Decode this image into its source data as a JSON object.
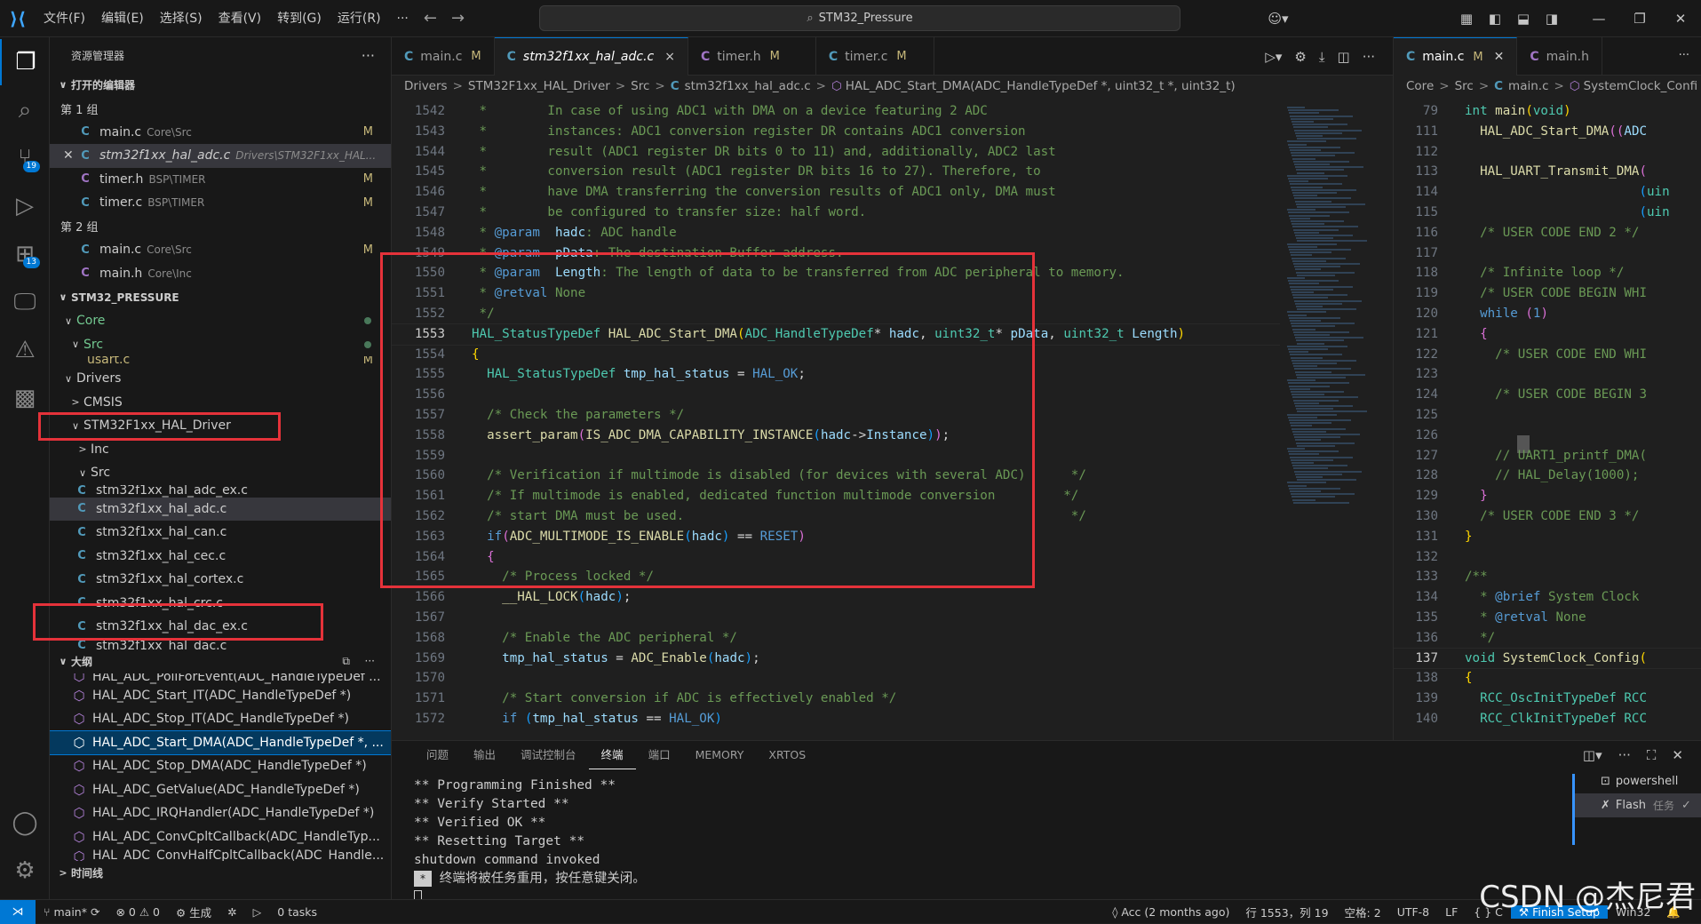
{
  "titlebar": {
    "menu": [
      "文件(F)",
      "编辑(E)",
      "选择(S)",
      "查看(V)",
      "转到(G)",
      "运行(R)",
      "···"
    ],
    "search": "STM32_Pressure"
  },
  "activity": {
    "scm_badge": "19",
    "ext_badge": "13"
  },
  "sidebar": {
    "title": "资源管理器",
    "open_editors_label": "打开的编辑器",
    "group1_label": "第 1 组",
    "group2_label": "第 2 组",
    "open_editors_g1": [
      {
        "name": "main.c",
        "path": "Core\\Src",
        "status": "M"
      },
      {
        "name": "stm32f1xx_hal_adc.c",
        "path": "Drivers\\STM32F1xx_HAL...",
        "status": ""
      },
      {
        "name": "timer.h",
        "path": "BSP\\TIMER",
        "status": "M"
      },
      {
        "name": "timer.c",
        "path": "BSP\\TIMER",
        "status": "M"
      }
    ],
    "open_editors_g2": [
      {
        "name": "main.c",
        "path": "Core\\Src",
        "status": "M"
      },
      {
        "name": "main.h",
        "path": "Core\\Inc",
        "status": ""
      }
    ],
    "project_label": "STM32_PRESSURE",
    "tree": {
      "core": "Core",
      "src": "Src",
      "usart": "usart.c",
      "usart_status": "M",
      "drivers": "Drivers",
      "cmsis": "CMSIS",
      "hal_driver": "STM32F1xx_HAL_Driver",
      "inc": "Inc",
      "src2": "Src",
      "files": [
        "stm32f1xx_hal_adc_ex.c",
        "stm32f1xx_hal_adc.c",
        "stm32f1xx_hal_can.c",
        "stm32f1xx_hal_cec.c",
        "stm32f1xx_hal_cortex.c",
        "stm32f1xx_hal_crc.c",
        "stm32f1xx_hal_dac_ex.c",
        "stm32f1xx_hal_dac.c"
      ]
    },
    "outline_label": "大纲",
    "outline": [
      "HAL_ADC_PollForEvent(ADC_HandleTypeDef ...",
      "HAL_ADC_Start_IT(ADC_HandleTypeDef *)",
      "HAL_ADC_Stop_IT(ADC_HandleTypeDef *)",
      "HAL_ADC_Start_DMA(ADC_HandleTypeDef *, ...",
      "HAL_ADC_Stop_DMA(ADC_HandleTypeDef *)",
      "HAL_ADC_GetValue(ADC_HandleTypeDef *)",
      "HAL_ADC_IRQHandler(ADC_HandleTypeDef *)",
      "HAL_ADC_ConvCpltCallback(ADC_HandleTyp...",
      "HAL_ADC_ConvHalfCpltCallback(ADC_Handle..."
    ],
    "timeline_label": "时间线"
  },
  "editor1": {
    "tabs": [
      {
        "name": "main.c",
        "status": "M"
      },
      {
        "name": "stm32f1xx_hal_adc.c",
        "status": "×"
      },
      {
        "name": "timer.h",
        "status": "M"
      },
      {
        "name": "timer.c",
        "status": "M"
      }
    ],
    "breadcrumb": [
      "Drivers",
      "STM32F1xx_HAL_Driver",
      "Src",
      "stm32f1xx_hal_adc.c",
      "HAL_ADC_Start_DMA(ADC_HandleTypeDef *, uint32_t *, uint32_t)"
    ],
    "line_numbers": [
      "1542",
      "1543",
      "1544",
      "1545",
      "1546",
      "1547",
      "1548",
      "1549",
      "1550",
      "1551",
      "1552",
      "1553",
      "1554",
      "1555",
      "1556",
      "1557",
      "1558",
      "1559",
      "1560",
      "1561",
      "1562",
      "1563",
      "1564",
      "1565",
      "1566",
      "1567",
      "1568",
      "1569",
      "1570",
      "1571",
      "1572"
    ],
    "current_line": "1553"
  },
  "editor2": {
    "tabs": [
      {
        "name": "main.c",
        "status": "M"
      },
      {
        "name": "main.h",
        "status": ""
      }
    ],
    "breadcrumb": [
      "Core",
      "Src",
      "main.c",
      "SystemClock_Confi"
    ],
    "line_numbers": [
      "79",
      "111",
      "112",
      "113",
      "114",
      "115",
      "116",
      "117",
      "118",
      "119",
      "120",
      "121",
      "122",
      "123",
      "124",
      "125",
      "126",
      "127",
      "128",
      "129",
      "130",
      "131",
      "132",
      "133",
      "134",
      "135",
      "136",
      "137",
      "138",
      "139",
      "140"
    ],
    "current_line": "137"
  },
  "panel": {
    "tabs": [
      "问题",
      "输出",
      "调试控制台",
      "终端",
      "端口",
      "MEMORY",
      "XRTOS"
    ],
    "terminal_lines": [
      "** Programming Finished **",
      "** Verify Started **",
      "** Verified OK **",
      "** Resetting Target **",
      "shutdown command invoked"
    ],
    "terminal_reuse_msg": "终端将被任务重用，按任意键关闭。",
    "terminal_list": [
      {
        "name": "powershell",
        "extra": ""
      },
      {
        "name": "Flash",
        "extra": "任务"
      }
    ]
  },
  "statusbar": {
    "branch": "main*",
    "errors": "0",
    "warnings": "0",
    "build": "生成",
    "tasks": "0 tasks",
    "acc": "Acc (2 months ago)",
    "position": "行 1553，列 19",
    "spaces": "空格: 2",
    "encoding": "UTF-8",
    "eol": "LF",
    "lang": "{ } C",
    "finish": "Finish Setup",
    "platform": "Win32"
  },
  "watermark": "CSDN @杰尼君"
}
